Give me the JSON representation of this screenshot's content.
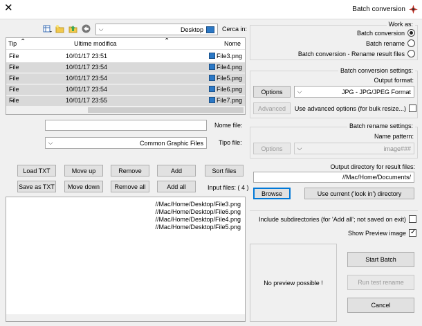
{
  "window": {
    "title": "Batch conversion",
    "close_glyph": "✕"
  },
  "browser": {
    "look_in_label": "Cerca in:",
    "look_in_value": "Desktop",
    "columns": {
      "name": "Nome",
      "modified": "Ultime modifica",
      "type": "Tip"
    },
    "files": [
      {
        "name": "File3.png",
        "modified": "10/01/17 23:51",
        "type": "File",
        "selected": false
      },
      {
        "name": "File4.png",
        "modified": "10/01/17 23:54",
        "type": "File",
        "selected": true
      },
      {
        "name": "File5.png",
        "modified": "10/01/17 23:54",
        "type": "File",
        "selected": true
      },
      {
        "name": "File6.png",
        "modified": "10/01/17 23:54",
        "type": "File",
        "selected": true
      },
      {
        "name": "File7.png",
        "modified": "10/01/17 23:55",
        "type": "File",
        "selected": true
      }
    ],
    "file_name_label": "Nome file:",
    "file_name_value": "",
    "file_type_label": "Tipo file:",
    "file_type_value": "Common Graphic Files"
  },
  "actions": {
    "sort_files": "Sort files",
    "add": "Add",
    "remove": "Remove",
    "move_up": "Move up",
    "load_txt": "Load TXT",
    "input_files_label": "Input files: ( 4 )",
    "add_all": "Add all",
    "remove_all": "Remove all",
    "move_down": "Move down",
    "save_as_txt": "Save as TXT"
  },
  "input_files": [
    "//Mac/Home/Desktop/File3.png",
    "//Mac/Home/Desktop/File6.png",
    "//Mac/Home/Desktop/File4.png",
    "//Mac/Home/Desktop/File5.png"
  ],
  "work_as": {
    "legend": "Work as:",
    "options": [
      {
        "label": "Batch conversion",
        "checked": true
      },
      {
        "label": "Batch rename",
        "checked": false
      },
      {
        "label": "Batch conversion - Rename result files",
        "checked": false
      }
    ]
  },
  "conversion": {
    "legend": "Batch conversion settings:",
    "output_format_label": "Output format:",
    "output_format_value": "JPG - JPG/JPEG Format",
    "options_button": "Options",
    "advanced_label": "Use advanced options (for bulk resize...)",
    "advanced_checked": false,
    "advanced_button": "Advanced"
  },
  "rename": {
    "legend": "Batch rename settings:",
    "pattern_label": "Name pattern:",
    "pattern_value": "image###",
    "options_button": "Options"
  },
  "output_dir": {
    "legend": "Output directory for result files:",
    "path_value": "//Mac/Home/Documents/",
    "use_current_button": "Use current ('look in') directory",
    "browse_button": "Browse"
  },
  "checks": {
    "include_subdirs": "Include subdirectories (for 'Add all'; not saved on exit)",
    "include_subdirs_checked": false,
    "show_preview": "Show Preview image",
    "show_preview_checked": true
  },
  "preview": {
    "text": "No preview possible !"
  },
  "run": {
    "start_batch": "Start Batch",
    "run_test_rename": "Run test rename",
    "cancel": "Cancel"
  },
  "colors": {
    "focus": "#0078d7",
    "selection": "#d9d9d9",
    "folder_icon": "#2b78c5"
  },
  "icons": [
    "close-icon",
    "app-icon",
    "dropdown-arrow-icon",
    "folder-icon",
    "back-icon",
    "up-folder-icon",
    "new-folder-icon",
    "view-menu-icon",
    "file-icon",
    "sort-up-icon",
    "sort-down-icon"
  ]
}
